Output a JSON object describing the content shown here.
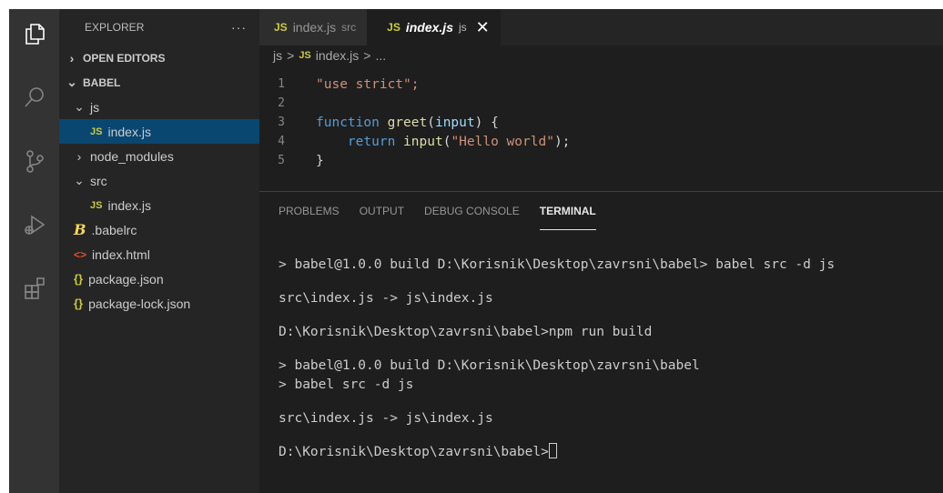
{
  "sidebar": {
    "title": "EXPLORER",
    "more": "···",
    "open_editors": "OPEN EDITORS",
    "project": "BABEL",
    "tree": [
      {
        "label": "js",
        "icon": "",
        "indent": 1
      },
      {
        "label": "index.js",
        "icon": "JS",
        "indent": 2
      },
      {
        "label": "node_modules",
        "icon": "",
        "indent": 1
      },
      {
        "label": "src",
        "icon": "",
        "indent": 1
      },
      {
        "label": "index.js",
        "icon": "JS",
        "indent": 2
      },
      {
        "label": ".babelrc",
        "icon": "B",
        "indent": 1
      },
      {
        "label": "index.html",
        "icon": "<>",
        "indent": 1
      },
      {
        "label": "package.json",
        "icon": "{}",
        "indent": 1
      },
      {
        "label": "package-lock.json",
        "icon": "{}",
        "indent": 1
      }
    ]
  },
  "tabs": [
    {
      "badge": "JS",
      "name": "index.js",
      "desc": "src"
    },
    {
      "badge": "JS",
      "name": "index.js",
      "desc": "js",
      "close": "✕"
    }
  ],
  "breadcrumb": {
    "folder": "js",
    "sep": ">",
    "badge": "JS",
    "file": "index.js",
    "more": "..."
  },
  "code": {
    "lines": [
      "1",
      "2",
      "3",
      "4",
      "5"
    ],
    "l1": "\"use strict\";",
    "l3_kw": "function",
    "l3_fn": "greet",
    "l3_param": "input",
    "l4_kw": "return",
    "l4_fn": "input",
    "l4_str": "\"Hello world\"",
    "l5": "}"
  },
  "panel": {
    "tabs": [
      "PROBLEMS",
      "OUTPUT",
      "DEBUG CONSOLE",
      "TERMINAL"
    ],
    "terminal": [
      "> babel@1.0.0 build D:\\Korisnik\\Desktop\\zavrsni\\babel> babel src -d js",
      "src\\index.js -> js\\index.js",
      "D:\\Korisnik\\Desktop\\zavrsni\\babel>npm run build",
      "> babel@1.0.0 build D:\\Korisnik\\Desktop\\zavrsni\\babel",
      "> babel src -d js",
      "src\\index.js -> js\\index.js",
      "D:\\Korisnik\\Desktop\\zavrsni\\babel>"
    ]
  },
  "colors": {
    "accent": "#094771",
    "keyword": "#569cd6",
    "function": "#dcdcaa",
    "string": "#ce9178",
    "js_badge": "#cbcb41"
  }
}
